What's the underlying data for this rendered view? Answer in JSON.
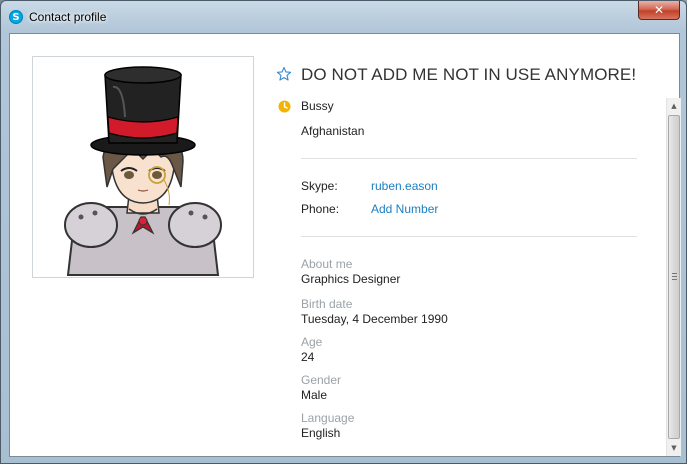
{
  "window": {
    "title": "Contact profile",
    "close_label": "✕"
  },
  "profile": {
    "display_name": "DO NOT ADD ME NOT IN USE ANYMORE!",
    "status": "Bussy",
    "country": "Afghanistan",
    "skype_label": "Skype:",
    "skype_value": "ruben.eason",
    "phone_label": "Phone:",
    "phone_value": "Add Number",
    "fields": [
      {
        "label": "About me",
        "value": "Graphics Designer"
      },
      {
        "label": "Birth date",
        "value": "Tuesday, 4 December 1990"
      },
      {
        "label": "Age",
        "value": "24"
      },
      {
        "label": "Gender",
        "value": "Male"
      },
      {
        "label": "Language",
        "value": "English"
      }
    ]
  },
  "colors": {
    "link": "#1b7fc2",
    "status_away": "#f2b400",
    "skype_brand": "#00a8e6"
  },
  "icons": {
    "favorite": "star-outline-icon",
    "status": "clock-icon"
  }
}
